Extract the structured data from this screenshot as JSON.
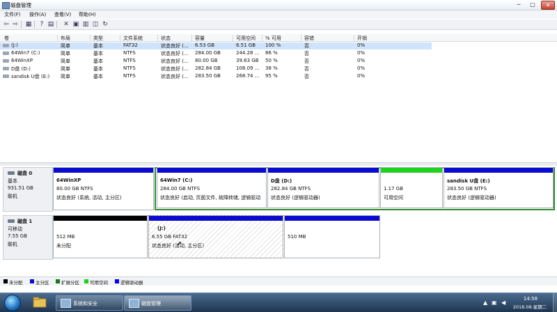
{
  "window": {
    "title": "磁盘管理",
    "min": "─",
    "max": "□",
    "close": "✕"
  },
  "menu": [
    "文件(F)",
    "操作(A)",
    "查看(V)",
    "帮助(H)"
  ],
  "toolbar": {
    "icons": [
      "back-icon",
      "forward-icon",
      "list-view-icon",
      "help-icon",
      "properties-icon",
      "delete-icon",
      "open-icon",
      "explore-icon",
      "disk-icon",
      "rescan-icon"
    ],
    "glyphs": [
      "⇦",
      "⇨",
      "▦",
      "?",
      "▤",
      "✕",
      "▣",
      "▥",
      "◫",
      "↻"
    ]
  },
  "table": {
    "columns": [
      "卷",
      "布局",
      "类型",
      "文件系统",
      "状态",
      "容量",
      "可用空间",
      "% 可用",
      "容错",
      "开销"
    ],
    "rows": [
      {
        "vol": "(J:)",
        "layout": "简单",
        "type": "基本",
        "fs": "FAT32",
        "status": "状态良好 (...",
        "cap": "6.53 GB",
        "free": "6.51 GB",
        "pct": "100 %",
        "ft": "否",
        "ovh": "0%"
      },
      {
        "vol": "64Win7 (C:)",
        "layout": "简单",
        "type": "基本",
        "fs": "NTFS",
        "status": "状态良好 (...",
        "cap": "284.00 GB",
        "free": "244.28 ...",
        "pct": "86 %",
        "ft": "否",
        "ovh": "0%"
      },
      {
        "vol": "64WinXP",
        "layout": "简单",
        "type": "基本",
        "fs": "NTFS",
        "status": "状态良好 (...",
        "cap": "80.00 GB",
        "free": "39.63 GB",
        "pct": "50 %",
        "ft": "否",
        "ovh": "0%"
      },
      {
        "vol": "D盘 (D:)",
        "layout": "简单",
        "type": "基本",
        "fs": "NTFS",
        "status": "状态良好 (...",
        "cap": "282.84 GB",
        "free": "108.09 ...",
        "pct": "38 %",
        "ft": "否",
        "ovh": "0%"
      },
      {
        "vol": "sandisk U盘 (E:)",
        "layout": "简单",
        "type": "基本",
        "fs": "NTFS",
        "status": "状态良好 (...",
        "cap": "283.50 GB",
        "free": "268.74 ...",
        "pct": "95 %",
        "ft": "否",
        "ovh": "0%"
      }
    ]
  },
  "disks": [
    {
      "name": "磁盘 0",
      "kind": "基本",
      "size": "931.51 GB",
      "state": "联机",
      "parts": [
        {
          "name": "64WinXP",
          "size": "80.00 GB NTFS",
          "status": "状态良好 (系统, 活动, 主分区)",
          "color": "#0a0ad0"
        },
        {
          "name": "64Win7  (C:)",
          "size": "284.00 GB NTFS",
          "status": "状态良好 (启动, 页面文件, 故障转储, 逻辑驱动",
          "color": "#0a0ad0"
        },
        {
          "name": "D盘  (D:)",
          "size": "282.84 GB NTFS",
          "status": "状态良好 (逻辑驱动器)",
          "color": "#0a0ad0"
        },
        {
          "name": "",
          "size": "1.17 GB",
          "status": "可用空间",
          "color": "#1ed21e"
        },
        {
          "name": "sandisk U盘  (E:)",
          "size": "283.50 GB NTFS",
          "status": "状态良好 (逻辑驱动器)",
          "color": "#0a0ad0"
        }
      ]
    },
    {
      "name": "磁盘 1",
      "kind": "可移动",
      "size": "7.55 GB",
      "state": "联机",
      "parts": [
        {
          "name": "",
          "size": "512 MB",
          "status": "未分配",
          "color": "#000000"
        },
        {
          "name": "(J:)",
          "size": "6.55 GB FAT32",
          "status": "状态良好 (活动, 主分区)",
          "color": "#0a0ad0"
        },
        {
          "name": "",
          "size": "510 MB",
          "status": "",
          "color": "#0a0ad0"
        }
      ]
    }
  ],
  "legend": [
    {
      "label": "未分配",
      "color": "#000000"
    },
    {
      "label": "主分区",
      "color": "#0a0ad0"
    },
    {
      "label": "扩展分区",
      "color": "#1a7a1a"
    },
    {
      "label": "可用空间",
      "color": "#1ed21e"
    },
    {
      "label": "逻辑驱动器",
      "color": "#0000ff"
    }
  ],
  "taskbar": {
    "tasks": [
      {
        "label": "系统和安全"
      },
      {
        "label": "磁盘管理"
      }
    ],
    "time": "14:58",
    "date": "2018.08.星期二"
  }
}
